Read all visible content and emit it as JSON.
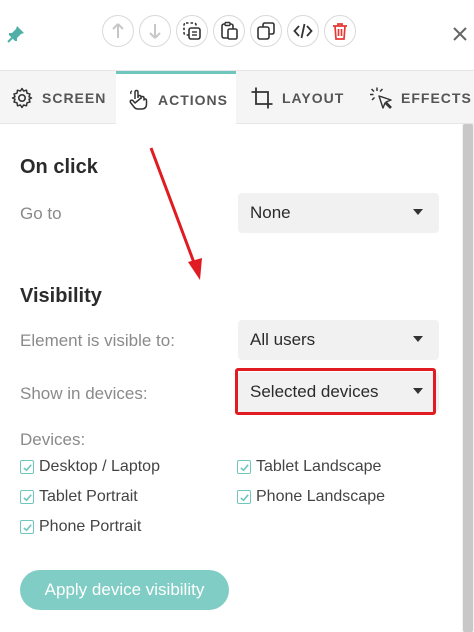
{
  "tabs": [
    {
      "label": "SCREEN",
      "icon": "gear-icon",
      "active": false
    },
    {
      "label": "ACTIONS",
      "icon": "hand-pointer-icon",
      "active": true
    },
    {
      "label": "LAYOUT",
      "icon": "crop-icon",
      "active": false
    },
    {
      "label": "EFFECTS",
      "icon": "sparkle-cursor-icon",
      "active": false
    }
  ],
  "toolbar": {
    "buttons": [
      "arrow-up-icon",
      "arrow-down-icon",
      "copy-dashed-icon",
      "paste-icon",
      "duplicate-icon",
      "code-icon",
      "trash-icon"
    ]
  },
  "on_click": {
    "title": "On click",
    "goto_label": "Go to",
    "goto_value": "None"
  },
  "visibility": {
    "title": "Visibility",
    "visible_to_label": "Element is visible to:",
    "visible_to_value": "All users",
    "show_in_devices_label": "Show in devices:",
    "show_in_devices_value": "Selected devices",
    "devices_label": "Devices:",
    "devices": [
      {
        "label": "Desktop / Laptop",
        "checked": true
      },
      {
        "label": "Tablet Landscape",
        "checked": true
      },
      {
        "label": "Tablet Portrait",
        "checked": true
      },
      {
        "label": "Phone Landscape",
        "checked": true
      },
      {
        "label": "Phone Portrait",
        "checked": true
      }
    ],
    "apply_label": "Apply device visibility"
  },
  "colors": {
    "accent": "#6ec6bd",
    "apply_button": "#7fcdc5",
    "annotation_red": "#e11b22",
    "delete_red": "#e53935",
    "pin": "#4fb0a7"
  }
}
